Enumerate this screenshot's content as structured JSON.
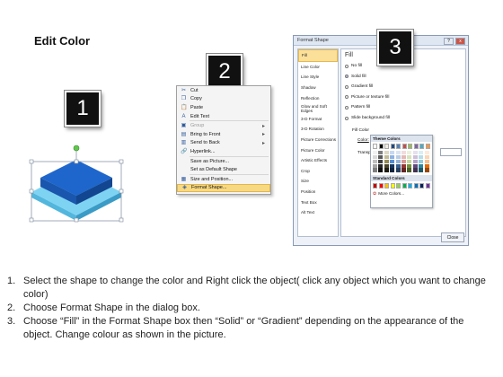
{
  "title": "Edit Color",
  "badges": [
    "1",
    "2",
    "3"
  ],
  "context_menu": {
    "items": [
      {
        "icon": "scissors-icon",
        "glyph": "✂",
        "label": "Cut",
        "submenu": false,
        "disabled": false
      },
      {
        "icon": "copy-icon",
        "glyph": "❐",
        "label": "Copy",
        "submenu": false,
        "disabled": false
      },
      {
        "icon": "paste-icon",
        "glyph": "📋",
        "label": "Paste",
        "submenu": false,
        "disabled": false
      },
      {
        "icon": "edit-text-icon",
        "glyph": "A",
        "label": "Edit Text",
        "submenu": false,
        "disabled": false
      },
      {
        "icon": "group-icon",
        "glyph": "▣",
        "label": "Group",
        "submenu": true,
        "disabled": true
      },
      {
        "icon": "bring-to-front-icon",
        "glyph": "▤",
        "label": "Bring to Front",
        "submenu": true,
        "disabled": false
      },
      {
        "icon": "send-to-back-icon",
        "glyph": "▥",
        "label": "Send to Back",
        "submenu": true,
        "disabled": false
      },
      {
        "icon": "hyperlink-icon",
        "glyph": "🔗",
        "label": "Hyperlink...",
        "submenu": false,
        "disabled": false
      },
      {
        "icon": "",
        "glyph": "",
        "label": "Save as Picture...",
        "submenu": false,
        "disabled": false
      },
      {
        "icon": "",
        "glyph": "",
        "label": "Set as Default Shape",
        "submenu": false,
        "disabled": false
      },
      {
        "icon": "size-position-icon",
        "glyph": "▦",
        "label": "Size and Position...",
        "submenu": false,
        "disabled": false
      },
      {
        "icon": "format-shape-icon",
        "glyph": "◈",
        "label": "Format Shape...",
        "submenu": false,
        "disabled": false,
        "highlighted": true
      }
    ]
  },
  "dialog": {
    "title": "Format Shape",
    "window_buttons": [
      "?",
      "x"
    ],
    "nav": [
      "Fill",
      "Line Color",
      "Line Style",
      "Shadow",
      "Reflection",
      "Glow and Soft Edges",
      "3-D Format",
      "3-D Rotation",
      "Picture Corrections",
      "Picture Color",
      "Artistic Effects",
      "Crop",
      "Size",
      "Position",
      "Text Box",
      "Alt Text"
    ],
    "selected_nav": "Fill",
    "panel_heading": "Fill",
    "fill_options": [
      "No fill",
      "Solid fill",
      "Gradient fill",
      "Picture or texture fill",
      "Pattern fill",
      "Slide background fill"
    ],
    "selected_fill": "Solid fill",
    "sub_heading": "Fill Color",
    "color_label": "Color:",
    "transparency_label": "Transpa",
    "close_label": "Close"
  },
  "palette": {
    "theme_label": "Theme Colors",
    "standard_label": "Standard Colors",
    "more_label": "More Colors...",
    "theme_top": [
      "#ffffff",
      "#000000",
      "#eeece1",
      "#1f497d",
      "#4f81bd",
      "#c0504d",
      "#9bbb59",
      "#8064a2",
      "#4bacc6",
      "#f79646"
    ],
    "theme_columns": [
      [
        "#f2f2f2",
        "#d9d9d9",
        "#bfbfbf",
        "#a6a6a6",
        "#808080"
      ],
      [
        "#7f7f7f",
        "#595959",
        "#3f3f3f",
        "#262626",
        "#0d0d0d"
      ],
      [
        "#ddd9c3",
        "#c4bd97",
        "#948a54",
        "#4a452a",
        "#1d1b10"
      ],
      [
        "#c6d9f0",
        "#8db3e2",
        "#548dd4",
        "#17365d",
        "#0f243e"
      ],
      [
        "#dbe5f1",
        "#b8cce4",
        "#95b3d7",
        "#366092",
        "#244061"
      ],
      [
        "#f2dcdb",
        "#e5b9b7",
        "#d99694",
        "#953734",
        "#632423"
      ],
      [
        "#ebf1dd",
        "#d7e3bc",
        "#c3d69b",
        "#76923c",
        "#4f6128"
      ],
      [
        "#e5e0ec",
        "#ccc1d9",
        "#b2a2c7",
        "#5f497a",
        "#3f3151"
      ],
      [
        "#dbeef3",
        "#b7dde8",
        "#92cddc",
        "#31859b",
        "#205867"
      ],
      [
        "#fdeada",
        "#fbd5b5",
        "#fac08f",
        "#e36c09",
        "#974806"
      ]
    ],
    "standard": [
      "#c00000",
      "#ff0000",
      "#ffc000",
      "#ffff00",
      "#92d050",
      "#00b050",
      "#00b0f0",
      "#0070c0",
      "#002060",
      "#7030a0"
    ]
  },
  "instructions": [
    {
      "num": "1.",
      "text": "Select the shape to change the color and Right click the object( click any object which you want to change color)"
    },
    {
      "num": "2.",
      "text": "Choose Format Shape in the dialog box."
    },
    {
      "num": "3.",
      "text": "Choose “Fill” in the Format Shape box then “Solid” or “Gradient” depending on the appearance of the object. Change colour as shown in the picture."
    }
  ]
}
